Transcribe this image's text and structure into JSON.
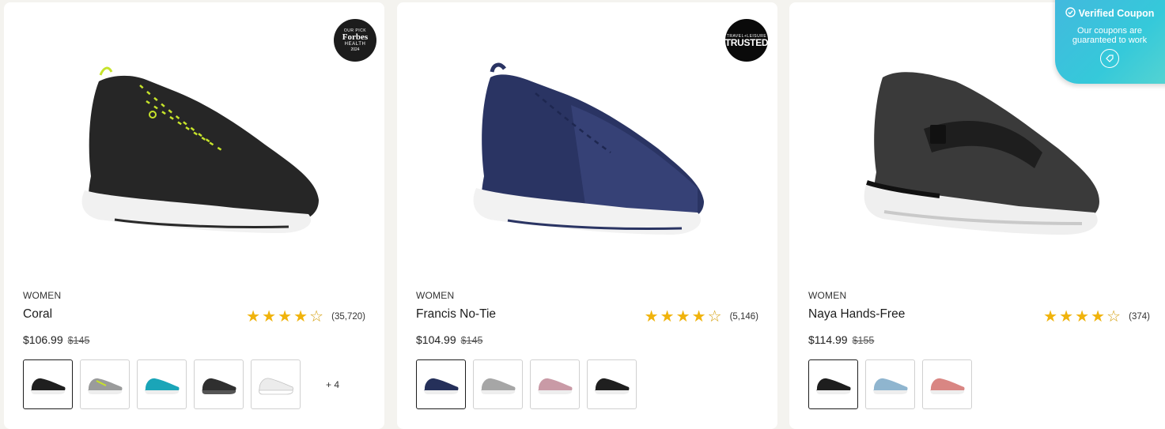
{
  "products": [
    {
      "category": "WOMEN",
      "name": "Coral",
      "sale_price": "$106.99",
      "original_price": "$145",
      "rating": 4.6,
      "review_count": "(35,720)",
      "badge": {
        "top": "OUR PICK",
        "mid": "Forbes",
        "sub": "HEALTH",
        "year": "2024"
      },
      "colors": [
        "#2b2b2b",
        "#9aa3a3",
        "#1aa5b8",
        "#3a3a3a",
        "#e8e8e8"
      ],
      "accent": "#c6e32b",
      "swatches": [
        {
          "color": "#1f1f1f",
          "accent": "#c7e12a",
          "selected": true
        },
        {
          "color": "#9a9b9b",
          "accent": "#c7e12a",
          "selected": false
        },
        {
          "color": "#1aa5b8",
          "accent": "#0f5e6b",
          "selected": false
        },
        {
          "color": "#2f2f2f",
          "accent": "#555555",
          "selected": false
        },
        {
          "color": "#ececec",
          "accent": "#c2c2c2",
          "selected": false
        }
      ],
      "more_label": "+ 4"
    },
    {
      "category": "WOMEN",
      "name": "Francis No-Tie",
      "sale_price": "$104.99",
      "original_price": "$145",
      "rating": 4.6,
      "review_count": "(5,146)",
      "badge": {
        "top": "TRAVEL+LEISURE",
        "mid": "TRUSTED",
        "sub": "",
        "year": ""
      },
      "swatches": [
        {
          "color": "#25305a",
          "accent": "#2f3c6e",
          "selected": true
        },
        {
          "color": "#a6a6a6",
          "accent": "#888888",
          "selected": false
        },
        {
          "color": "#c99aa6",
          "accent": "#b07f8c",
          "selected": false
        },
        {
          "color": "#1f1f1f",
          "accent": "#333333",
          "selected": false
        }
      ],
      "more_label": ""
    },
    {
      "category": "WOMEN",
      "name": "Naya Hands-Free",
      "sale_price": "$114.99",
      "original_price": "$155",
      "rating": 4.6,
      "review_count": "(374)",
      "badge": null,
      "swatches": [
        {
          "color": "#1e1e1e",
          "accent": "#444444",
          "selected": true
        },
        {
          "color": "#8fb5cf",
          "accent": "#6b97b5",
          "selected": false
        },
        {
          "color": "#d98683",
          "accent": "#c06a67",
          "selected": false
        }
      ],
      "more_label": ""
    }
  ],
  "coupon": {
    "title": "Verified Coupon",
    "subtitle_line1": "Our coupons are",
    "subtitle_line2": "guaranteed to work"
  }
}
